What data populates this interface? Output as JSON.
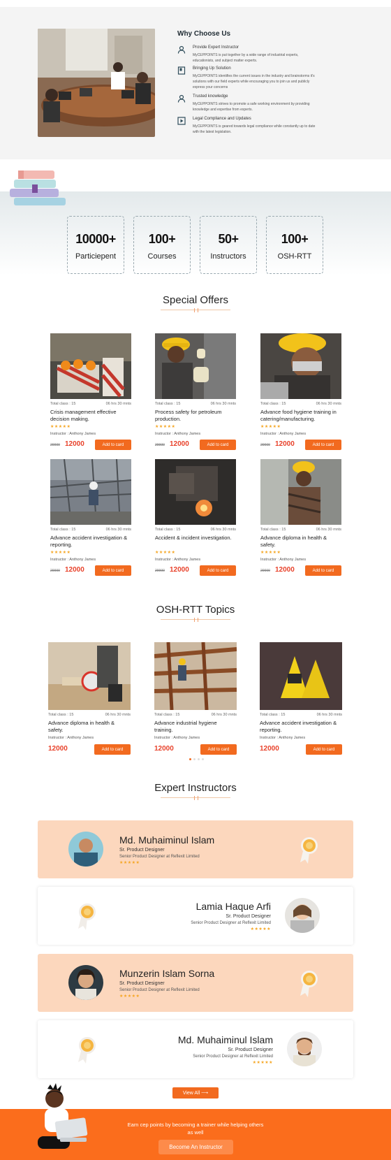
{
  "why": {
    "title": "Why Choose Us",
    "items": [
      {
        "icon": "user-icon",
        "title": "Provide Expert Instructor",
        "desc": "MyCEPPOINTS is put together by a wide range of industrial experts, educationists, and subject matter experts."
      },
      {
        "icon": "book-icon",
        "title": "Bringing Up Solution",
        "desc": "MyCEPPOINTS identifies the current issues in the industry and brainstorms it's solutions with our field experts while encouraging you to join us and publicly express your concerns"
      },
      {
        "icon": "user-icon",
        "title": "Trusted knowledge",
        "desc": "MyCEPPOINTS strives to promote a safe working environment by providing knowledge and expertise from experts."
      },
      {
        "icon": "play-icon",
        "title": "Legal Compliance and Updates",
        "desc": "MyCEPPOINTS is geared towards legal compliance while constantly up to date with the latest legislation."
      }
    ]
  },
  "stats": [
    {
      "number": "10000+",
      "label": "Particiepent"
    },
    {
      "number": "100+",
      "label": "Courses"
    },
    {
      "number": "50+",
      "label": "Instructors"
    },
    {
      "number": "100+",
      "label": "OSH-RTT"
    }
  ],
  "offers": {
    "title": "Special Offers",
    "cards": [
      {
        "total": "Total class : 15",
        "hours": "06 hrs 30 mnts",
        "title": "Crisis management effective decision making.",
        "stars": "★★★★★",
        "instructor": "Instructor : Anthony James",
        "old": "20000",
        "price": "12000",
        "button": "Add to card"
      },
      {
        "total": "Total class : 15",
        "hours": "06 hrs 30 mnts",
        "title": "Process safety for petroleum production.",
        "stars": "★★★★★",
        "instructor": "Instructor : Anthony James",
        "old": "20000",
        "price": "12000",
        "button": "Add to card"
      },
      {
        "total": "Total class : 15",
        "hours": "06 hrs 30 mnts",
        "title": "Advance food hygiene training in catering/manufacturing.",
        "stars": "★★★★★",
        "instructor": "Instructor : Anthony James",
        "old": "20000",
        "price": "12000",
        "button": "Add to card"
      },
      {
        "total": "Total class : 15",
        "hours": "06 hrs 30 mnts",
        "title": "Advance accident investigation & reporting.",
        "stars": "★★★★★",
        "instructor": "Instructor : Anthony James",
        "old": "20000",
        "price": "12000",
        "button": "Add to card"
      },
      {
        "total": "Total class : 15",
        "hours": "06 hrs 30 mnts",
        "title": "Accident & incident investigation.",
        "stars": "★★★★★",
        "instructor": "Instructor : Anthony James",
        "old": "20000",
        "price": "12000",
        "button": "Add to card"
      },
      {
        "total": "Total class : 15",
        "hours": "06 hrs 30 mnts",
        "title": "Advance diploma in health & safety.",
        "stars": "★★★★★",
        "instructor": "Instructor : Anthony James",
        "old": "20000",
        "price": "12000",
        "button": "Add to card"
      }
    ]
  },
  "topics": {
    "title": "OSH-RTT Topics",
    "cards": [
      {
        "total": "Total class : 15",
        "hours": "06 hrs 30 mnts",
        "title": "Advance diploma in health & safety.",
        "instructor": "Instructor : Anthony James",
        "price": "12000",
        "button": "Add to card"
      },
      {
        "total": "Total class : 15",
        "hours": "06 hrs 30 mnts",
        "title": "Advance industrial hygiene training.",
        "instructor": "Instructor : Anthony James",
        "price": "12000",
        "button": "Add to card"
      },
      {
        "total": "Total class : 15",
        "hours": "06 hrs 30 mnts",
        "title": "Advance accident investigation & reporting.",
        "instructor": "Instructor : Anthony James",
        "price": "12000",
        "button": "Add to card"
      }
    ]
  },
  "instructors": {
    "title": "Expert Instructors",
    "list": [
      {
        "name": "Md. Muhaiminul Islam",
        "role": "Sr. Product Designer",
        "company": "Senior Product Designer at Reflexit Limited",
        "stars": "★★★★★"
      },
      {
        "name": "Lamia Haque Arfi",
        "role": "Sr. Product Designer",
        "company": "Senior Product Designer at Reflexit Limited",
        "stars": "★★★★★"
      },
      {
        "name": "Munzerin Islam Sorna",
        "role": "Sr. Product Designer",
        "company": "Senior Product Designer at Reflexit Limited",
        "stars": "★★★★★"
      },
      {
        "name": "Md. Muhaiminul Islam",
        "role": "Sr. Product Designer",
        "company": "Senior Product Designer at Reflexit Limited",
        "stars": "★★★★★"
      }
    ],
    "view_all": "View All ⟶"
  },
  "footer": {
    "text": "Earn cep points by becoming a trainer while helping others as well",
    "button": "Become An Instructor"
  },
  "colors": {
    "accent": "#f26a1f",
    "price": "#e8422b",
    "peach": "#fcd7bd",
    "star": "#f5a623"
  }
}
